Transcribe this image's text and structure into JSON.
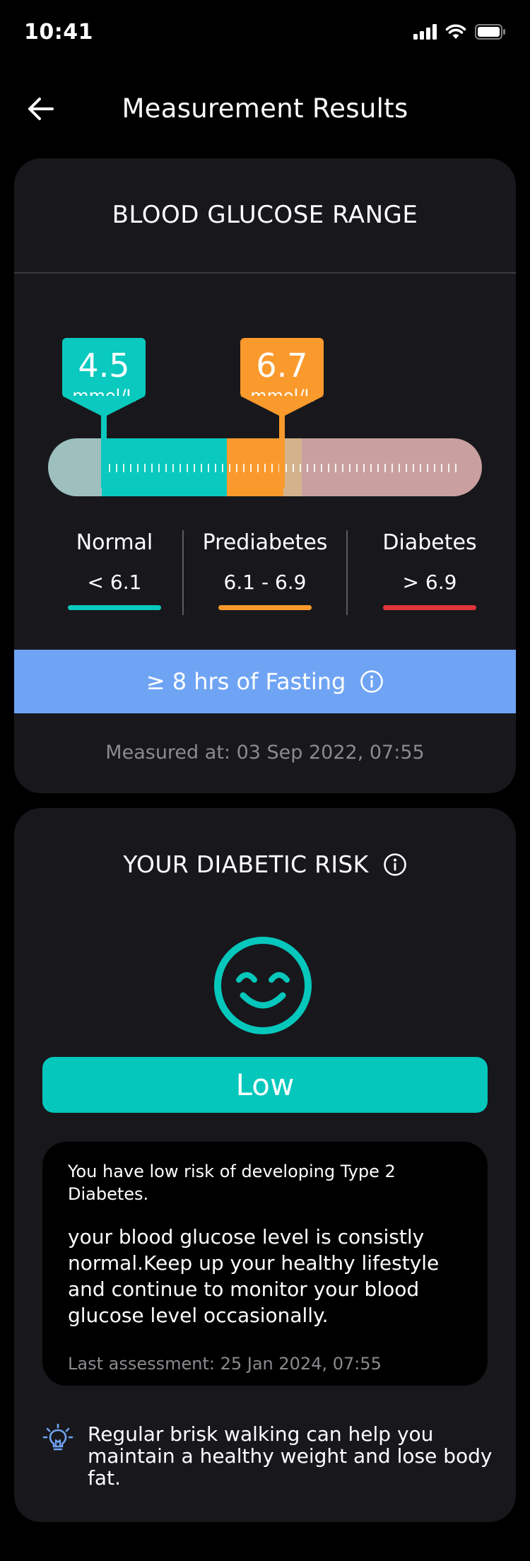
{
  "status_bar": {
    "time": "10:41"
  },
  "header": {
    "title": "Measurement Results"
  },
  "range_card": {
    "title": "BLOOD GLUCOSE RANGE",
    "markers": [
      {
        "value": "4.5",
        "unit": "mmol/L",
        "color": "#0ac9be"
      },
      {
        "value": "6.7",
        "unit": "mmol/L",
        "color": "#fb9a2c"
      }
    ],
    "categories": [
      {
        "name": "Normal",
        "range": "< 6.1",
        "color": "#0ac9be"
      },
      {
        "name": "Prediabetes",
        "range": "6.1 - 6.9",
        "color": "#fb9a2c"
      },
      {
        "name": "Diabetes",
        "range": "> 6.9",
        "color": "#e0353b"
      }
    ],
    "fasting_label": "≥ 8 hrs of Fasting",
    "measured_at": "Measured at: 03 Sep 2022, 07:55"
  },
  "risk_card": {
    "title": "YOUR DIABETIC RISK",
    "level": "Low",
    "accent": "#06c7bc",
    "summary": "You have low risk of developing Type 2 Diabetes.",
    "detail": "your blood glucose level is consistly normal.Keep up your healthy lifestyle and continue to monitor your blood glucose level occasionally.",
    "last_assessment": "Last assessment: 25 Jan 2024, 07:55",
    "tip": "Regular brisk walking can help you maintain a healthy weight and lose body fat.",
    "tip_icon": "lightbulb-icon"
  }
}
